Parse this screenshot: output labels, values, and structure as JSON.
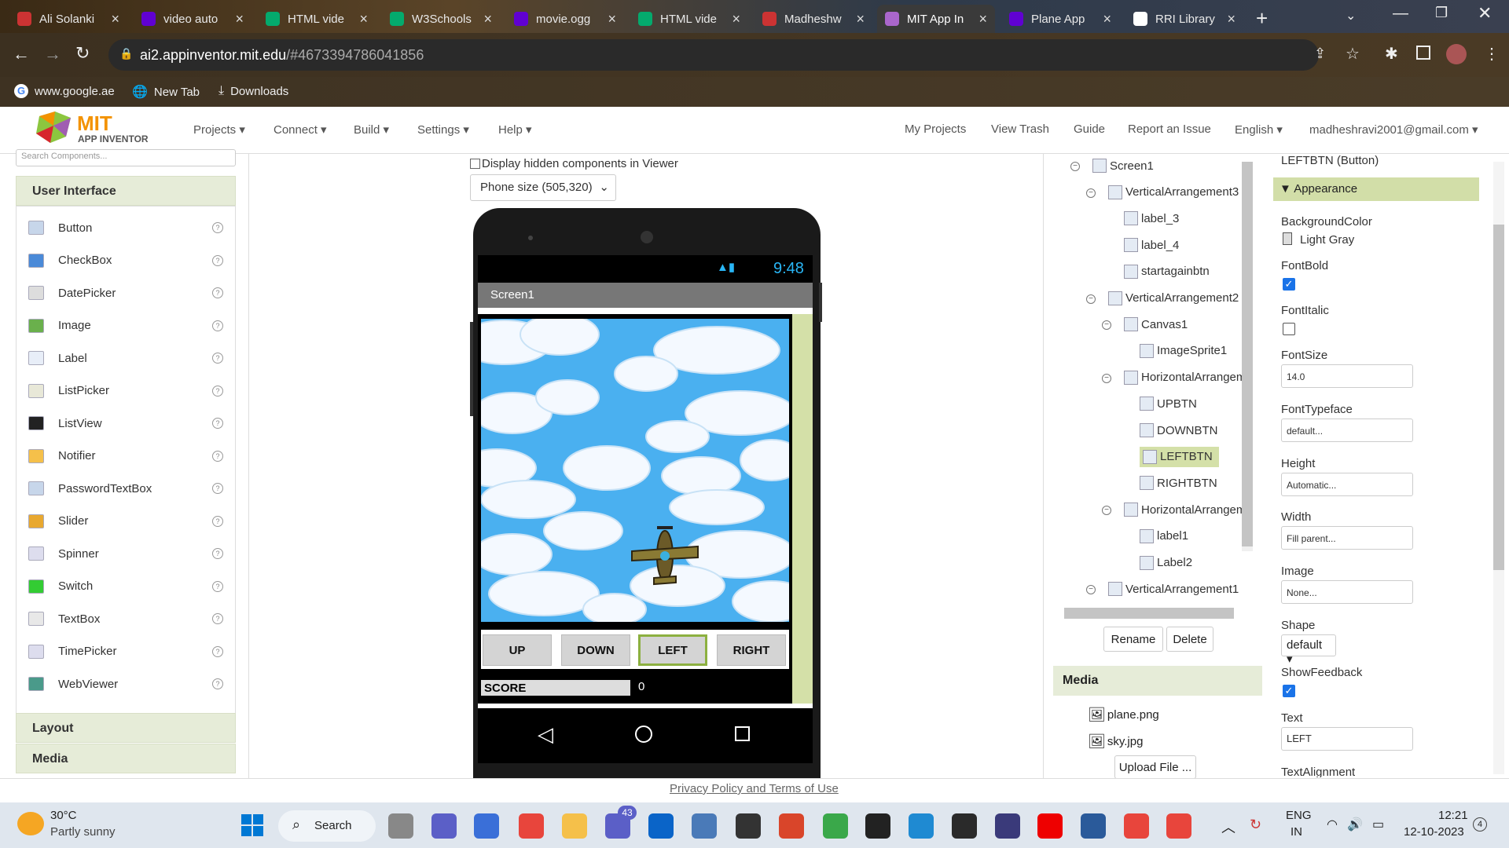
{
  "browser": {
    "tabs": [
      {
        "title": "Ali Solanki",
        "fav": "#c33"
      },
      {
        "title": "video auto",
        "fav": "#6001d2"
      },
      {
        "title": "HTML vide",
        "fav": "#04aa6d"
      },
      {
        "title": "W3Schools",
        "fav": "#04aa6d"
      },
      {
        "title": "movie.ogg",
        "fav": "#6001d2"
      },
      {
        "title": "HTML vide",
        "fav": "#04aa6d"
      },
      {
        "title": "Madheshw",
        "fav": "#c33"
      },
      {
        "title": "MIT App In",
        "fav": "#a6c"
      },
      {
        "title": "Plane App",
        "fav": "#6001d2"
      },
      {
        "title": "RRI Library",
        "fav": "#fff"
      }
    ],
    "url_host": "ai2.appinventor.mit.edu",
    "url_path": "/#4673394786041856",
    "bookmarks": [
      "www.google.ae",
      "New Tab",
      "Downloads"
    ]
  },
  "header": {
    "logo_mit": "MIT",
    "logo_sub": "APP INVENTOR",
    "menus": [
      "Projects",
      "Connect",
      "Build",
      "Settings",
      "Help"
    ],
    "right_links": [
      "My Projects",
      "View Trash",
      "Guide",
      "Report an Issue",
      "English",
      "madheshravi2001@gmail.com"
    ]
  },
  "palette": {
    "search_placeholder": "Search Components...",
    "section": "User Interface",
    "items": [
      "Button",
      "CheckBox",
      "DatePicker",
      "Image",
      "Label",
      "ListPicker",
      "ListView",
      "Notifier",
      "PasswordTextBox",
      "Slider",
      "Spinner",
      "Switch",
      "TextBox",
      "TimePicker",
      "WebViewer"
    ],
    "sections_below": [
      "Layout",
      "Media"
    ]
  },
  "viewer": {
    "hidden_label": "Display hidden components in Viewer",
    "phone_size": "Phone size (505,320)",
    "time": "9:48",
    "screen_title": "Screen1",
    "buttons": [
      "UP",
      "DOWN",
      "LEFT",
      "RIGHT"
    ],
    "score_label": "SCORE",
    "score_value": "0"
  },
  "components": {
    "tree": [
      {
        "name": "Screen1",
        "level": 0,
        "toggle": "⊖"
      },
      {
        "name": "VerticalArrangement3",
        "level": 1,
        "toggle": "⊖"
      },
      {
        "name": "label_3",
        "level": 2,
        "toggle": ""
      },
      {
        "name": "label_4",
        "level": 2,
        "toggle": ""
      },
      {
        "name": "startagainbtn",
        "level": 2,
        "toggle": ""
      },
      {
        "name": "VerticalArrangement2",
        "level": 1,
        "toggle": "⊖"
      },
      {
        "name": "Canvas1",
        "level": 2,
        "toggle": "⊖"
      },
      {
        "name": "ImageSprite1",
        "level": 3,
        "toggle": ""
      },
      {
        "name": "HorizontalArrangem",
        "level": 2,
        "toggle": "⊖"
      },
      {
        "name": "UPBTN",
        "level": 3,
        "toggle": ""
      },
      {
        "name": "DOWNBTN",
        "level": 3,
        "toggle": ""
      },
      {
        "name": "LEFTBTN",
        "level": 3,
        "toggle": "",
        "selected": true
      },
      {
        "name": "RIGHTBTN",
        "level": 3,
        "toggle": ""
      },
      {
        "name": "HorizontalArrangem",
        "level": 2,
        "toggle": "⊖"
      },
      {
        "name": "label1",
        "level": 3,
        "toggle": ""
      },
      {
        "name": "Label2",
        "level": 3,
        "toggle": ""
      },
      {
        "name": "VerticalArrangement1",
        "level": 1,
        "toggle": "⊖"
      }
    ],
    "rename": "Rename",
    "delete": "Delete",
    "media_title": "Media",
    "media_files": [
      "plane.png",
      "sky.jpg"
    ],
    "upload": "Upload File ..."
  },
  "properties": {
    "title": "LEFTBTN (Button)",
    "section": "Appearance",
    "bgcolor_label": "BackgroundColor",
    "bgcolor_value": "Light Gray",
    "fontbold_label": "FontBold",
    "fontbold": true,
    "fontitalic_label": "FontItalic",
    "fontitalic": false,
    "fontsize_label": "FontSize",
    "fontsize_value": "14.0",
    "fonttypeface_label": "FontTypeface",
    "fonttypeface_value": "default...",
    "height_label": "Height",
    "height_value": "Automatic...",
    "width_label": "Width",
    "width_value": "Fill parent...",
    "image_label": "Image",
    "image_value": "None...",
    "shape_label": "Shape",
    "shape_value": "default",
    "showfeedback_label": "ShowFeedback",
    "showfeedback": true,
    "text_label": "Text",
    "text_value": "LEFT",
    "textalign_label": "TextAlignment"
  },
  "footer": {
    "privacy": "Privacy Policy and Terms of Use"
  },
  "taskbar": {
    "temp": "30°C",
    "weather": "Partly sunny",
    "search": "Search",
    "badge": "43",
    "lang1": "ENG",
    "lang2": "IN",
    "time": "12:21",
    "date": "12-10-2023",
    "notif": "4"
  }
}
